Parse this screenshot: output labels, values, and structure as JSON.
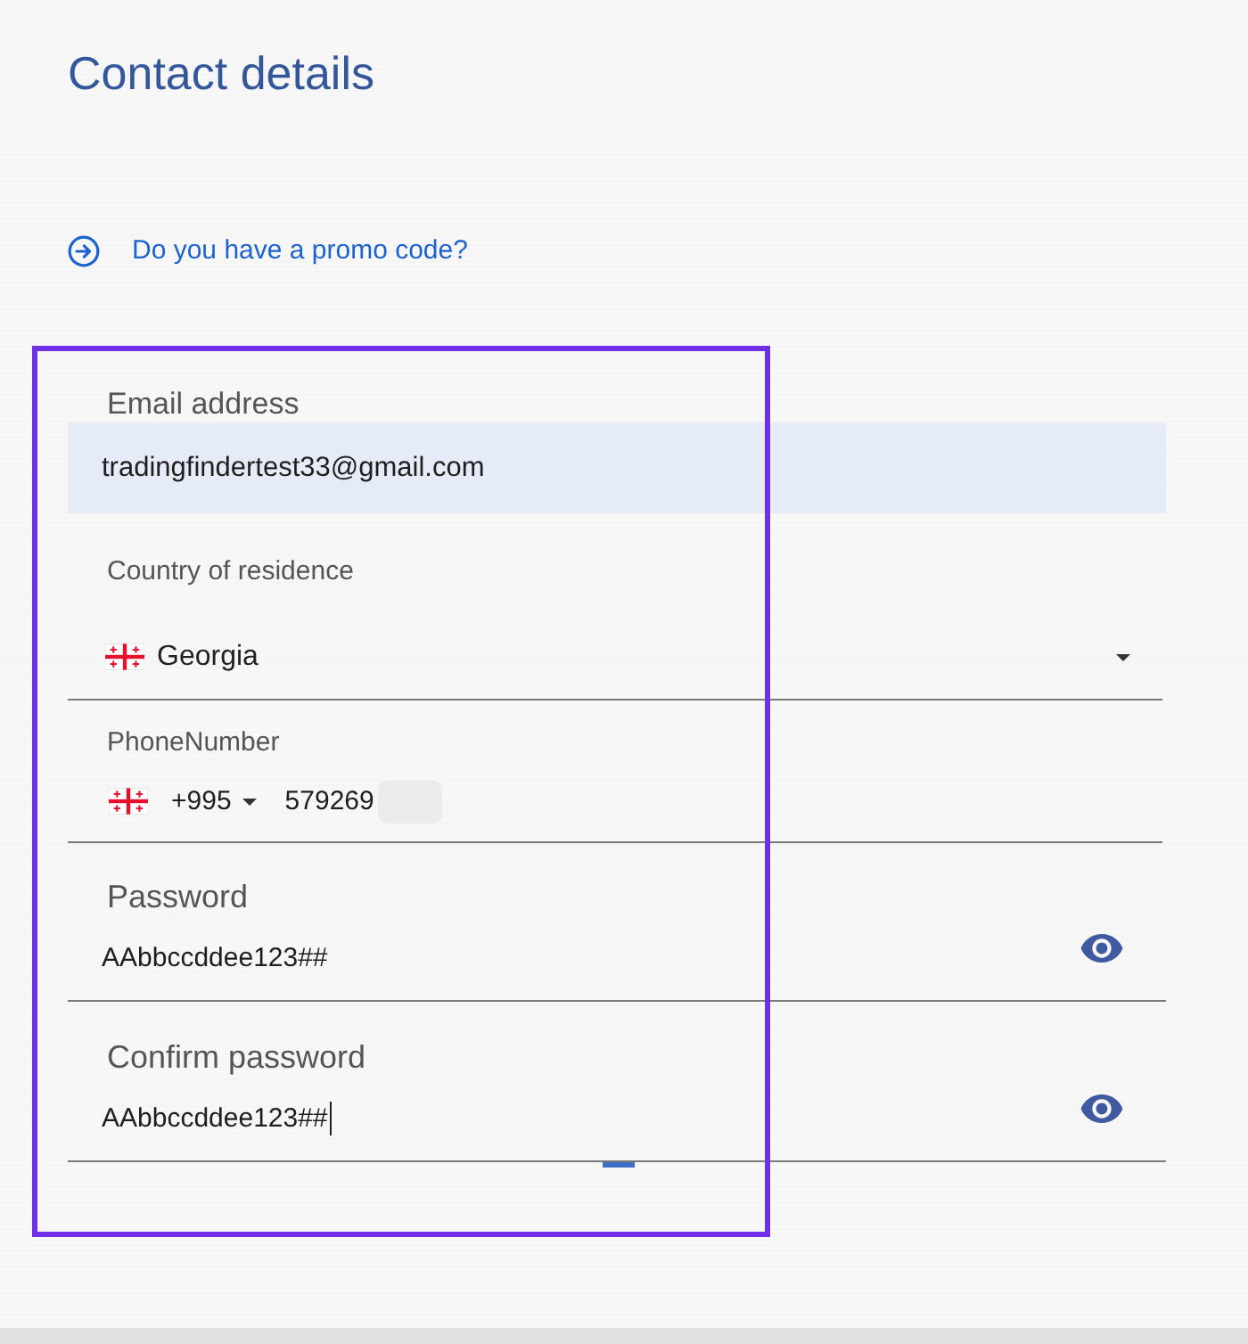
{
  "title": "Contact details",
  "promo_link": {
    "label": "Do you have a promo code?"
  },
  "fields": [
    {
      "kind": "email",
      "label": "Email address",
      "value": "tradingfindertest33@gmail.com",
      "focused": false
    },
    {
      "kind": "select",
      "label": "Country of residence",
      "value": "Georgia",
      "focused": false
    },
    {
      "kind": "phone",
      "label": "PhoneNumber",
      "country_code": "+995",
      "value": "579269",
      "redacted": true,
      "focused": false
    },
    {
      "kind": "password",
      "label": "Password",
      "value": "AAbbccddee123##",
      "focused": false
    },
    {
      "kind": "password",
      "label": "Confirm password",
      "value": "AAbbccddee123##",
      "focused": true
    }
  ]
}
